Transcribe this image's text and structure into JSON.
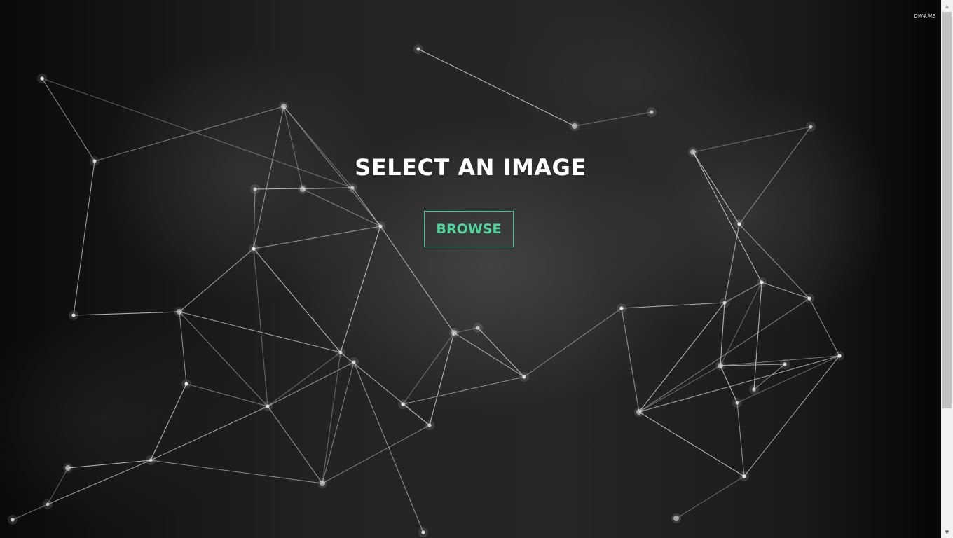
{
  "watermark": {
    "text": "DW4.ME"
  },
  "main": {
    "title": "SELECT AN IMAGE",
    "browse_label": "BROWSE"
  },
  "colors": {
    "accent": "#3ec48e",
    "title": "#ffffff",
    "background": "#1e1e1e"
  },
  "scrollbar": {
    "up_icon": "triangle-up-icon",
    "down_icon": "triangle-down-icon",
    "up_glyph": "▲",
    "down_glyph": "▼"
  }
}
